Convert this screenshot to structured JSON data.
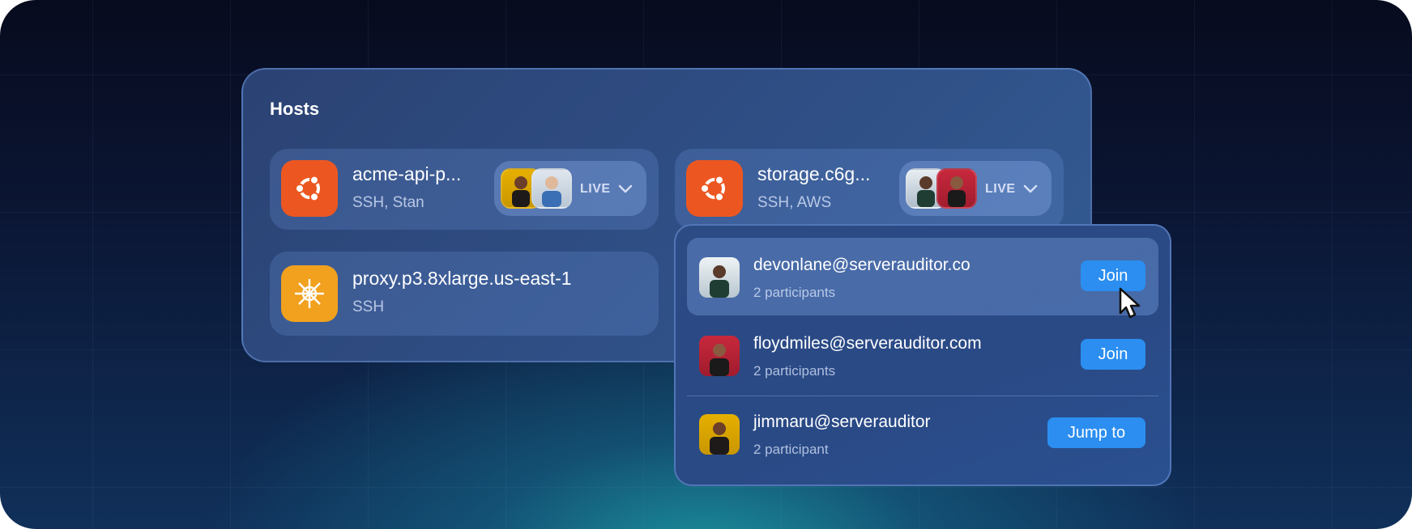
{
  "panel": {
    "title": "Hosts"
  },
  "hosts": [
    {
      "name": "acme-api-p...",
      "sub": "SSH, Stan",
      "logo": "ubuntu-icon",
      "live_label": "LIVE"
    },
    {
      "name": "storage.c6g...",
      "sub": "SSH, AWS",
      "logo": "ubuntu-icon",
      "live_label": "LIVE"
    },
    {
      "name": "proxy.p3.8xlarge.us-east-1",
      "sub": "SSH",
      "logo": "redhat-icon"
    }
  ],
  "sessions": [
    {
      "email": "devonlane@serverauditor.co",
      "participants": "2 participants",
      "action": "Join"
    },
    {
      "email": "floydmiles@serverauditor.com",
      "participants": "2 participants",
      "action": "Join"
    },
    {
      "email": "jimmaru@serverauditor",
      "participants": "2 participant",
      "action": "Jump to"
    }
  ],
  "colors": {
    "accent": "#2b8ef0",
    "ubuntu": "#ec5721",
    "rh": "#f1a11e"
  }
}
